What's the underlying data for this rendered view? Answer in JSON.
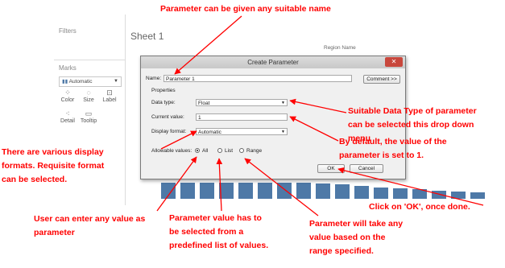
{
  "annotations": {
    "top": "Parameter can be given any suitable name",
    "datatype": [
      "Suitable Data Type of parameter",
      "can be selected this drop down",
      "menu"
    ],
    "default": [
      "By default, the value of the",
      "parameter is set to 1."
    ],
    "formats": [
      "There are various display",
      "formats. Requisite format",
      "can be selected."
    ],
    "ok": "Click on 'OK', once done.",
    "user": [
      "User can enter any value as",
      "parameter"
    ],
    "list": [
      "Parameter value has to",
      "be selected from a",
      "predefined list of values."
    ],
    "range": [
      "Parameter will take any",
      "value based on the",
      "range specified."
    ]
  },
  "workspace": {
    "filters_label": "Filters",
    "marks_label": "Marks",
    "mark_type": "Automatic",
    "mark_buttons": [
      "Color",
      "Size",
      "Label",
      "Detail",
      "Tooltip"
    ],
    "sheet_title": "Sheet 1",
    "region_header": "Region Name"
  },
  "dialog": {
    "title": "Create Parameter",
    "close_label": "✕",
    "name_label": "Name:",
    "name_value": "Parameter 1",
    "comment_button": "Comment >>",
    "properties_label": "Properties",
    "data_type_label": "Data type:",
    "data_type_value": "Float",
    "current_value_label": "Current value:",
    "current_value": "1",
    "display_format_label": "Display format:",
    "display_format_value": "Automatic",
    "allowable_label": "Allowable values:",
    "options": [
      "All",
      "List",
      "Range"
    ],
    "selected_option": "All",
    "ok_button": "OK",
    "cancel_button": "Cancel"
  },
  "chart_data": {
    "type": "bar",
    "values": [
      100,
      100,
      100,
      100,
      100,
      100,
      100,
      100,
      95,
      88,
      80,
      72,
      65,
      58,
      52,
      47,
      42
    ]
  },
  "colors": {
    "annotation": "#ff0000",
    "bar": "#4e79a7"
  }
}
